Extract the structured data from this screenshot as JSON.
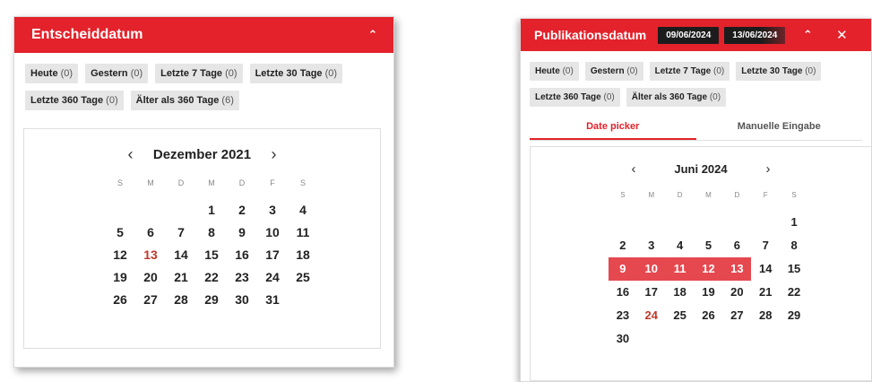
{
  "left_panel": {
    "title": "Entscheiddatum",
    "chips": [
      {
        "label": "Heute",
        "count": "(0)"
      },
      {
        "label": "Gestern",
        "count": "(0)"
      },
      {
        "label": "Letzte 7 Tage",
        "count": "(0)"
      },
      {
        "label": "Letzte 30 Tage",
        "count": "(0)"
      },
      {
        "label": "Letzte 360 Tage",
        "count": "(0)"
      },
      {
        "label": "Älter als 360 Tage",
        "count": "(6)"
      }
    ],
    "calendar": {
      "month_label": "Dezember 2021",
      "weekdays": [
        "S",
        "M",
        "D",
        "M",
        "D",
        "F",
        "S"
      ],
      "first_weekday_index": 3,
      "days_in_month": 31,
      "today": 13,
      "selected": []
    }
  },
  "right_panel": {
    "title": "Publikationsdatum",
    "date_from": "09/06/2024",
    "date_to": "13/06/2024",
    "chips": [
      {
        "label": "Heute",
        "count": "(0)"
      },
      {
        "label": "Gestern",
        "count": "(0)"
      },
      {
        "label": "Letzte 7 Tage",
        "count": "(0)"
      },
      {
        "label": "Letzte 30 Tage",
        "count": "(0)"
      },
      {
        "label": "Letzte 360 Tage",
        "count": "(0)"
      },
      {
        "label": "Älter als 360 Tage",
        "count": "(0)"
      }
    ],
    "tabs": [
      {
        "label": "Date picker",
        "active": true
      },
      {
        "label": "Manuelle Eingabe",
        "active": false
      }
    ],
    "calendar": {
      "month_label": "Juni 2024",
      "weekdays": [
        "S",
        "M",
        "D",
        "M",
        "D",
        "F",
        "S"
      ],
      "first_weekday_index": 6,
      "days_in_month": 30,
      "today": 24,
      "selected": [
        9,
        10,
        11,
        12,
        13
      ]
    }
  },
  "icons": {
    "prev": "chevron-left-icon",
    "next": "chevron-right-icon",
    "collapse": "chevron-up-icon",
    "close": "close-icon"
  },
  "colors": {
    "accent": "#e3222b",
    "selected_day_bg": "#e5484f",
    "today_text": "#c0392b",
    "chip_bg": "#e6e6e6"
  }
}
